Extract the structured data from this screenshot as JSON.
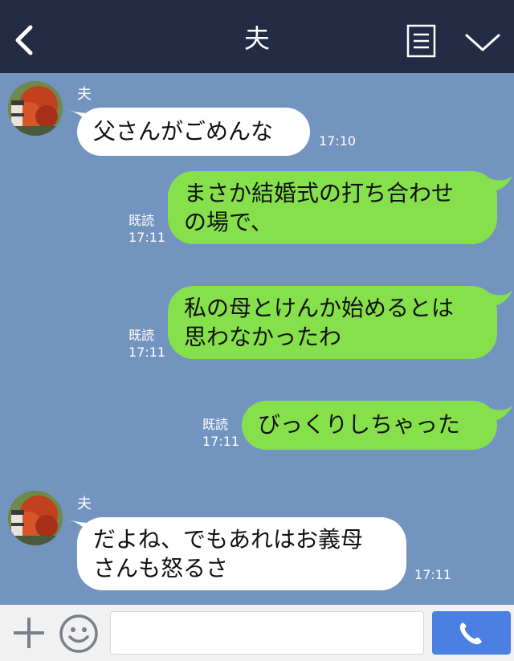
{
  "header": {
    "title": "夫",
    "back_icon": "chevron-left-icon",
    "notes_icon": "notes-icon",
    "menu_icon": "chevron-down-icon"
  },
  "messages": [
    {
      "type": "incoming",
      "sender": "夫",
      "text": "父さんがごめんな",
      "time": "17:10"
    },
    {
      "type": "outgoing",
      "read": "既読",
      "time": "17:11",
      "lines": [
        "まさか結婚式の打ち合わせ",
        "の場で、"
      ]
    },
    {
      "type": "outgoing",
      "read": "既読",
      "time": "17:11",
      "lines": [
        "私の母とけんか始めるとは",
        "思わなかったわ"
      ]
    },
    {
      "type": "outgoing",
      "read": "既読",
      "time": "17:11",
      "lines": [
        "びっくりしちゃった"
      ]
    },
    {
      "type": "incoming",
      "sender": "夫",
      "time": "17:11",
      "lines": [
        "だよね、でもあれはお義母",
        "さんも怒るさ"
      ]
    }
  ],
  "footer": {
    "input_value": "",
    "plus_icon": "plus-icon",
    "emoji_icon": "smiley-icon",
    "call_icon": "phone-icon"
  },
  "colors": {
    "header_bg": "#232c44",
    "chat_bg": "#7494c0",
    "incoming_bubble": "#ffffff",
    "outgoing_bubble": "#86e04c",
    "call_button": "#4b7fe3"
  }
}
